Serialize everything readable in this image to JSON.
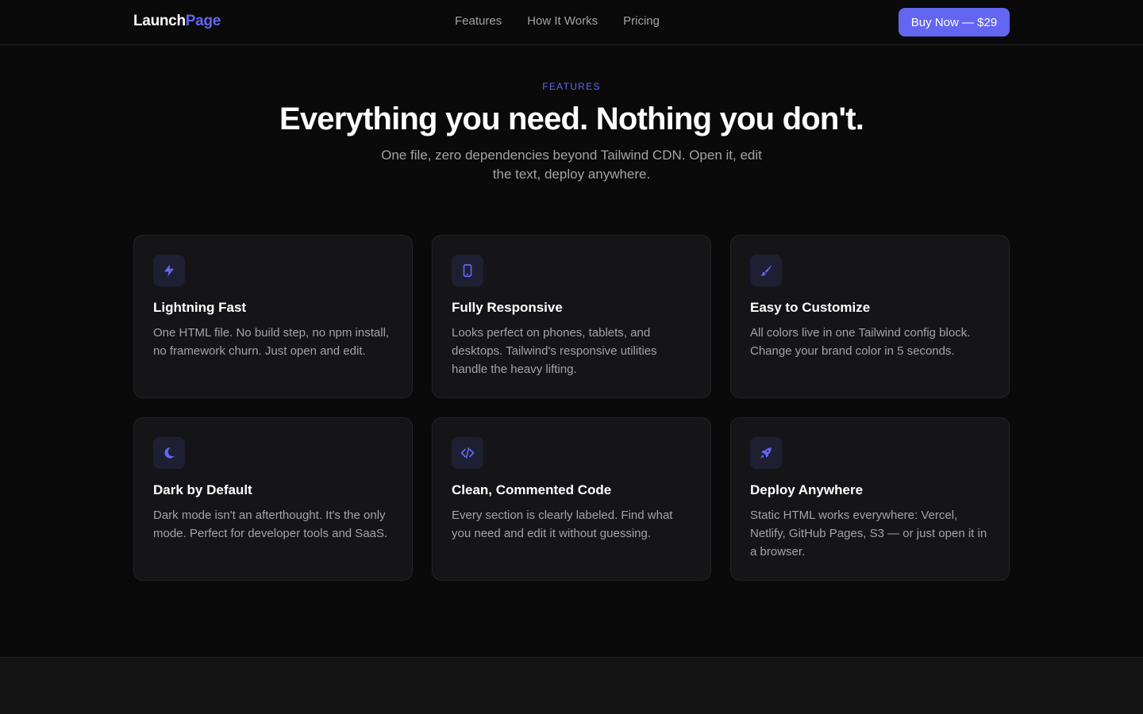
{
  "nav": {
    "logo_main": "Launch",
    "logo_accent": "Page",
    "links": [
      "Features",
      "How It Works",
      "Pricing"
    ],
    "cta": "Buy Now — $29"
  },
  "hero": {
    "eyebrow": "FEATURES",
    "headline": "Everything you need. Nothing you don't.",
    "subhead": "One file, zero dependencies beyond Tailwind CDN. Open it, edit the text, deploy anywhere."
  },
  "features": [
    {
      "icon": "lightning-icon",
      "title": "Lightning Fast",
      "desc": "One HTML file. No build step, no npm install, no framework churn. Just open and edit."
    },
    {
      "icon": "phone-icon",
      "title": "Fully Responsive",
      "desc": "Looks perfect on phones, tablets, and desktops. Tailwind's responsive utilities handle the heavy lifting."
    },
    {
      "icon": "brush-icon",
      "title": "Easy to Customize",
      "desc": "All colors live in one Tailwind config block. Change your brand color in 5 seconds."
    },
    {
      "icon": "moon-icon",
      "title": "Dark by Default",
      "desc": "Dark mode isn't an afterthought. It's the only mode. Perfect for developer tools and SaaS."
    },
    {
      "icon": "code-icon",
      "title": "Clean, Commented Code",
      "desc": "Every section is clearly labeled. Find what you need and edit it without guessing."
    },
    {
      "icon": "rocket-icon",
      "title": "Deploy Anywhere",
      "desc": "Static HTML works everywhere: Vercel, Netlify, GitHub Pages, S3 — or just open it in a browser."
    }
  ],
  "colors": {
    "accent": "#6366f1",
    "background": "#0a0a0a",
    "card": "#151517",
    "muted_text": "#a3a3a3"
  }
}
